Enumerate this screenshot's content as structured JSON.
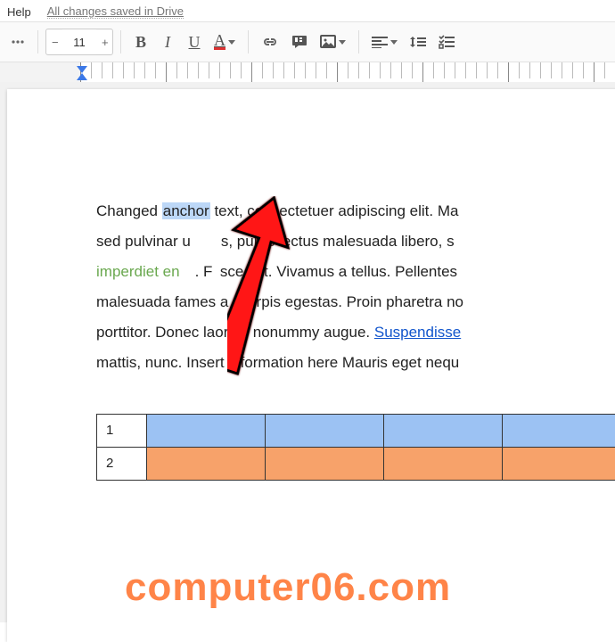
{
  "menubar": {
    "help": "Help",
    "save_status": "All changes saved in Drive"
  },
  "toolbar": {
    "font_size": "11"
  },
  "doc": {
    "p1a": "Changed ",
    "p1_hl": "anchor",
    "p1b": " text, consectetuer adipiscing elit. Ma",
    "p2a": "sed pulvinar u",
    "p2b": "s, purus lectus malesuada libero, s",
    "p3a": "imperdiet en",
    "p3b": ". F",
    "p3c": "sce est. Vivamus a tellus. Pellentes",
    "p4a": "malesuada fames a",
    "p4b": "turpis egestas. Proin pharetra no",
    "p5a": "porttitor. Donec laoree",
    "p5b": "nonummy augue. ",
    "p5_link": "Suspendisse",
    "p6": "mattis, nunc. Insert information here Mauris eget nequ"
  },
  "table": {
    "rows": [
      {
        "num": "1"
      },
      {
        "num": "2"
      }
    ]
  },
  "watermark": "computer06.com"
}
